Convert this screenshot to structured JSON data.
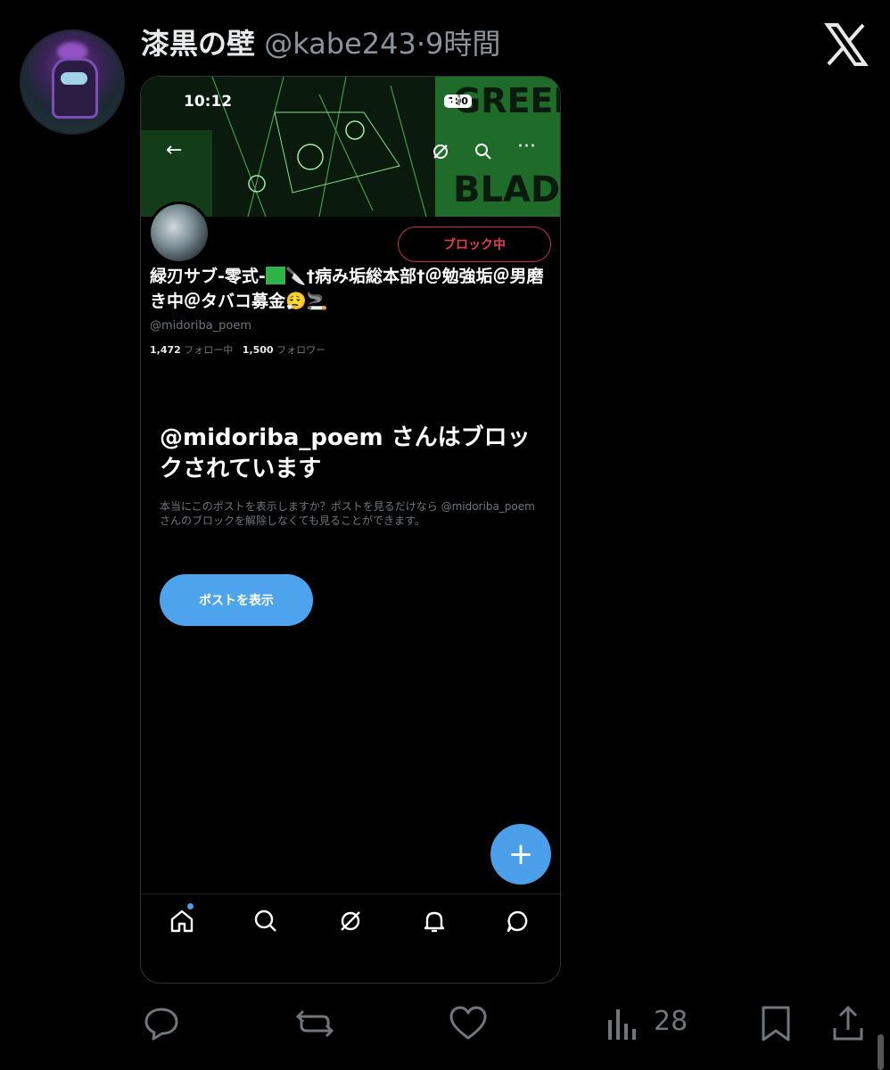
{
  "tweet": {
    "display_name": "漆黒の壁",
    "handle": "@kabe243",
    "separator": "·",
    "time": "9時間"
  },
  "embedded": {
    "status_time": "10:12",
    "battery": "100",
    "banner_text": [
      "GREEN",
      "BLADE"
    ],
    "block_button": "ブロック中",
    "display_name_part1": "緑刃サブ-零式-",
    "display_name_part2": "🔪",
    "display_name_part3": "†病み垢総本部†＠勉強垢＠男磨き中＠タバコ募金😮‍💨🚬",
    "handle": "@midoriba_poem",
    "following_count": "1,472",
    "following_label": "フォロー中",
    "followers_count": "1,500",
    "followers_label": "フォロワー",
    "blocked_title": "@midoriba_poem さんはブロックされています",
    "blocked_text": "本当にこのポストを表示しますか？ポストを見るだけなら @midoriba_poem さんのブロックを解除しなくても見ることができます。",
    "view_button": "ポストを表示",
    "fab": "+"
  },
  "actions": {
    "views": "28"
  },
  "colors": {
    "accent": "#4a9fe8",
    "block_red": "#e0404e",
    "banner_green": "#2fb347"
  }
}
